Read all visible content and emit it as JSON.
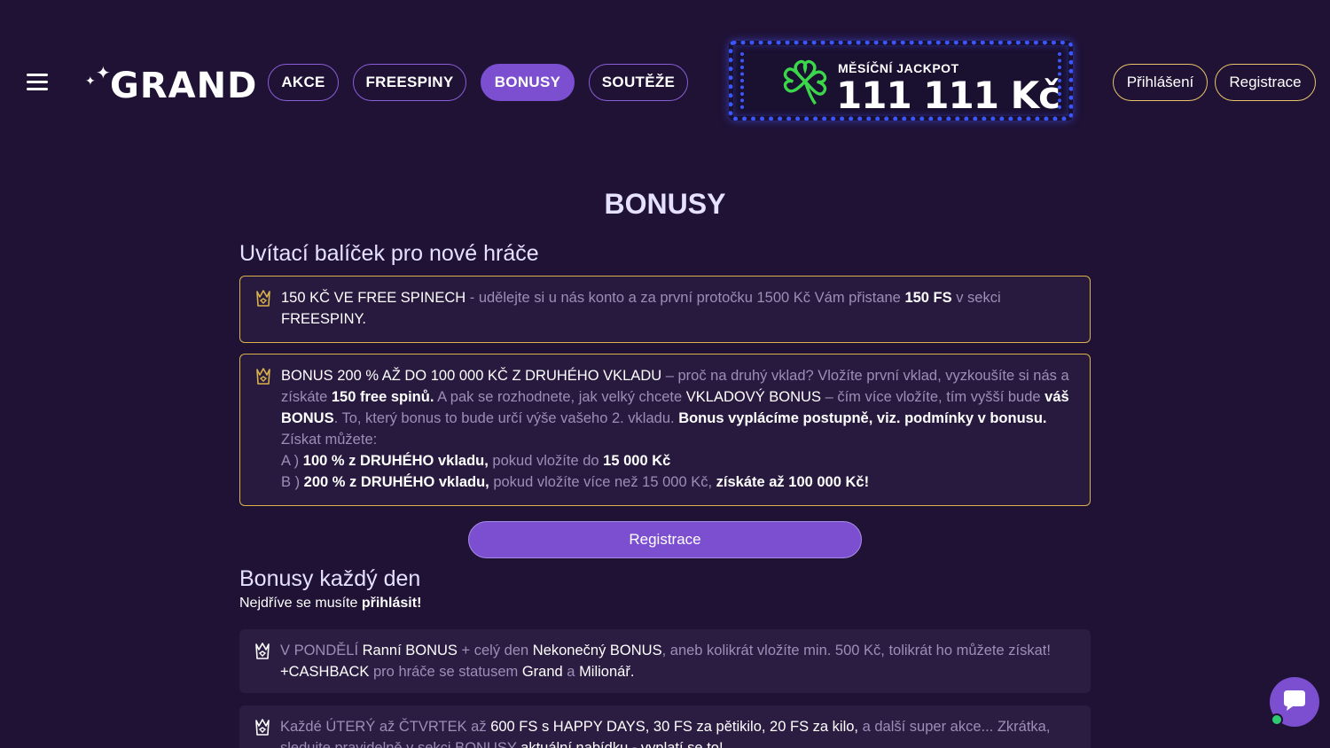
{
  "header": {
    "logo_text": "GRAND",
    "nav": [
      {
        "label": "AKCE",
        "active": false
      },
      {
        "label": "FREESPINY",
        "active": false
      },
      {
        "label": "BONUSY",
        "active": true
      },
      {
        "label": "SOUTĚŽE",
        "active": false
      }
    ],
    "jackpot": {
      "label": "MĚSÍČNÍ JACKPOT",
      "amount": "111 111 Kč"
    },
    "login_label": "Přihlášení",
    "register_label": "Registrace"
  },
  "main": {
    "title": "BONUSY",
    "welcome_title": "Uvítací balíček pro nové hráče",
    "card1": {
      "p1": "150 KČ VE FREE SPINECH",
      "p2": " - udělejte si u nás konto a za první protočku 1500 Kč Vám přistane ",
      "p3": "150 FS",
      "p4": " v sekci ",
      "p5": "FREESPINY."
    },
    "card2": {
      "p1": "BONUS 200 % AŽ DO 100 000 KČ Z DRUHÉHO VKLADU",
      "p2": " – proč na druhý vklad? Vložíte první vklad, vyzkoušíte si nás a získáte ",
      "p3": "150 free spinů.",
      "p4": " A pak se rozhodnete, jak velký chcete ",
      "p5": "VKLADOVÝ BONUS",
      "p6": " – čím více vložíte, tím vyšší bude ",
      "p7": "váš BONUS",
      "p8": ". To, který bonus to bude určí výše vašeho 2. vkladu. ",
      "p9": "Bonus vyplácíme postupně, viz. podmínky v bonusu.",
      "line_get": "Získat můžete:",
      "a_prefix": "A ) ",
      "a_bold1": "100 % z DRUHÉHO vkladu,",
      "a_mid": " pokud vložíte do ",
      "a_bold2": "15 000 Kč",
      "b_prefix": "B ) ",
      "b_bold1": "200 % z DRUHÉHO vkladu,",
      "b_mid": " pokud vložíte více než 15 000 Kč, ",
      "b_bold2": "získáte až 100 000 Kč!"
    },
    "register_button": "Registrace",
    "daily_title": "Bonusy každý den",
    "daily_note_pre": "Nejdříve se musíte ",
    "daily_note_bold": "přihlásit!",
    "card3": {
      "p1": "V PONDĚLÍ ",
      "p2": "Ranní BONUS",
      "p3": " + celý den ",
      "p4": "Nekonečný BONUS",
      "p5": ", aneb kolikrát vložíte min. 500 Kč, tolikrát ho můžete získat!",
      "p6": "+CASHBACK",
      "p7": " pro hráče se statusem ",
      "p8": "Grand",
      "p9": " a ",
      "p10": "Milionář."
    },
    "card4": {
      "p1": "Každé ÚTERÝ až ČTVRTEK až ",
      "p2": "600 FS s HAPPY DAYS, 30 FS za pětikilo, 20 FS za kilo,",
      "p3": " a další super akce... Zkrátka, sledujte pravidelně v sekci BONUSY ",
      "p4": "aktuální nabídku - vyplatí se to!"
    }
  },
  "colors": {
    "background": "#1f1235",
    "accent_purple": "#7b4fd0",
    "gold": "#d9b24c",
    "jackpot_blue": "#3a57ff",
    "clover_green": "#3cd64a"
  },
  "icons": [
    "menu-icon",
    "crown-icon",
    "clover-icon",
    "chat-icon"
  ]
}
